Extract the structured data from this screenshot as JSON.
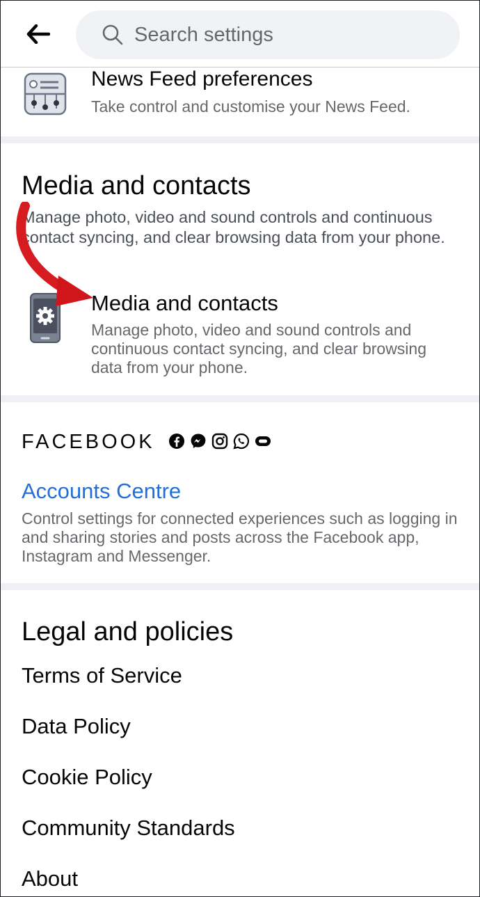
{
  "header": {
    "search_placeholder": "Search settings"
  },
  "news_feed": {
    "title": "News Feed preferences",
    "description": "Take control and customise your News Feed."
  },
  "media_section": {
    "heading": "Media and contacts",
    "description": "Manage photo, video and sound controls and continuous contact syncing, and clear browsing data from your phone.",
    "item_title": "Media and contacts",
    "item_description": "Manage photo, video and sound controls and continuous contact syncing, and clear browsing data from your phone."
  },
  "facebook_section": {
    "brand": "FACEBOOK",
    "icons": [
      "facebook-icon",
      "messenger-icon",
      "instagram-icon",
      "whatsapp-icon",
      "oculus-icon"
    ],
    "accounts_link": "Accounts Centre",
    "accounts_description": "Control settings for connected experiences such as logging in and sharing stories and posts across the Facebook app, Instagram and Messenger."
  },
  "legal": {
    "heading": "Legal and policies",
    "links": [
      "Terms of Service",
      "Data Policy",
      "Cookie Policy",
      "Community Standards",
      "About"
    ]
  },
  "colors": {
    "link_blue": "#216fdb",
    "annotation_arrow": "#d0161b",
    "secondary_text": "#65676b"
  }
}
